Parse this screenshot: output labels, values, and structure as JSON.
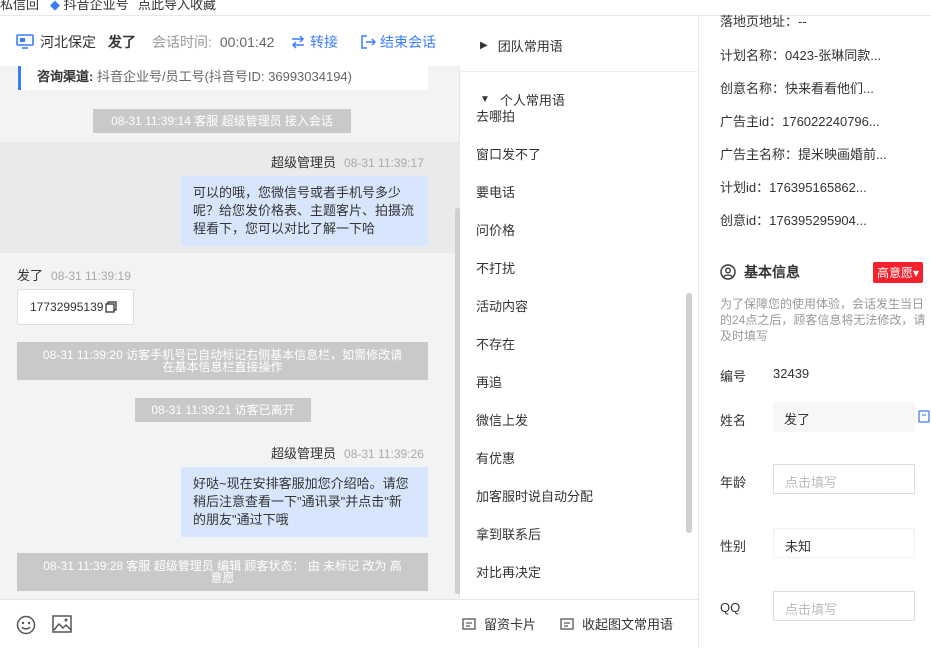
{
  "top_strip": {
    "left_text": "私信回",
    "tab_text": "抖音企业号",
    "link_text": "点此导入收藏"
  },
  "chat_header": {
    "location": "河北保定",
    "visitor_name": "发了",
    "session_time_label": "会话时间:",
    "session_time": "00:01:42",
    "transfer_label": "转接",
    "end_label": "结束会话"
  },
  "source_card": {
    "label": "咨询渠道:",
    "value": "抖音企业号/员工号(抖音号ID: 36993034194)"
  },
  "messages": {
    "sys1": "08-31 11:39:14 客服 超级管理员 接入会话",
    "agent1": {
      "sender": "超级管理员",
      "time": "08-31 11:39:17",
      "lines": [
        "可以的哦，您微信号或者手机号多少",
        "呢？给您发价格表、主题客片、拍摄流",
        "程看下，您可以对比了解一下哈"
      ]
    },
    "cust1": {
      "sender": "发了",
      "time": "08-31 11:39:19",
      "text": "17732995139"
    },
    "sys2": {
      "line1": "08-31 11:39:20 访客手机号已自动标记右侧基本信息栏，如需修改请",
      "line2": "在基本信息栏直接操作"
    },
    "sys3": "08-31 11:39:21 访客已离开",
    "agent2": {
      "sender": "超级管理员",
      "time": "08-31 11:39:26",
      "lines": [
        "好哒~现在安排客服加您介绍哈。请您",
        "稍后注意查看一下\"通讯录\"并点击\"新",
        "的朋友\"通过下哦"
      ]
    },
    "sys4": {
      "line1": "08-31 11:39:28 客服 超级管理员 编辑 顾客状态： 由 未标记 改为 高",
      "line2": "意愿"
    }
  },
  "phrases": {
    "team_group": "团队常用语",
    "personal_group": "个人常用语",
    "items": [
      "去哪拍",
      "窗口发不了",
      "要电话",
      "问价格",
      "不打扰",
      "活动内容",
      "不存在",
      "再追",
      "微信上发",
      "有优惠",
      "加客服时说自动分配",
      "拿到联系后",
      "对比再决定"
    ],
    "footer_card": "留资卡片",
    "footer_phrases": "收起图文常用语"
  },
  "info": {
    "kv": [
      "落地页地址：--",
      "计划名称：0423-张琳同款...",
      "创意名称：快来看看他们...",
      "广告主id：176022240796...",
      "广告主名称：提米映画婚前...",
      "计划id：176395165862...",
      "创意id：176395295904..."
    ],
    "section_title": "基本信息",
    "intent_badge": "高意愿▾",
    "notice": "为了保障您的使用体验，会话发生当日的24点之后，顾客信息将无法修改，请及时填写",
    "id_label": "编号",
    "id_value": "32439",
    "name_label": "姓名",
    "name_value": "发了",
    "age_label": "年龄",
    "age_placeholder": "点击填写",
    "gender_label": "性别",
    "gender_value": "未知",
    "qq_label": "QQ",
    "qq_placeholder": "点击填写"
  },
  "colors": {
    "accent": "#3b7cff",
    "agent_bubble": "#d8e6fd",
    "badge": "#f5222d"
  }
}
